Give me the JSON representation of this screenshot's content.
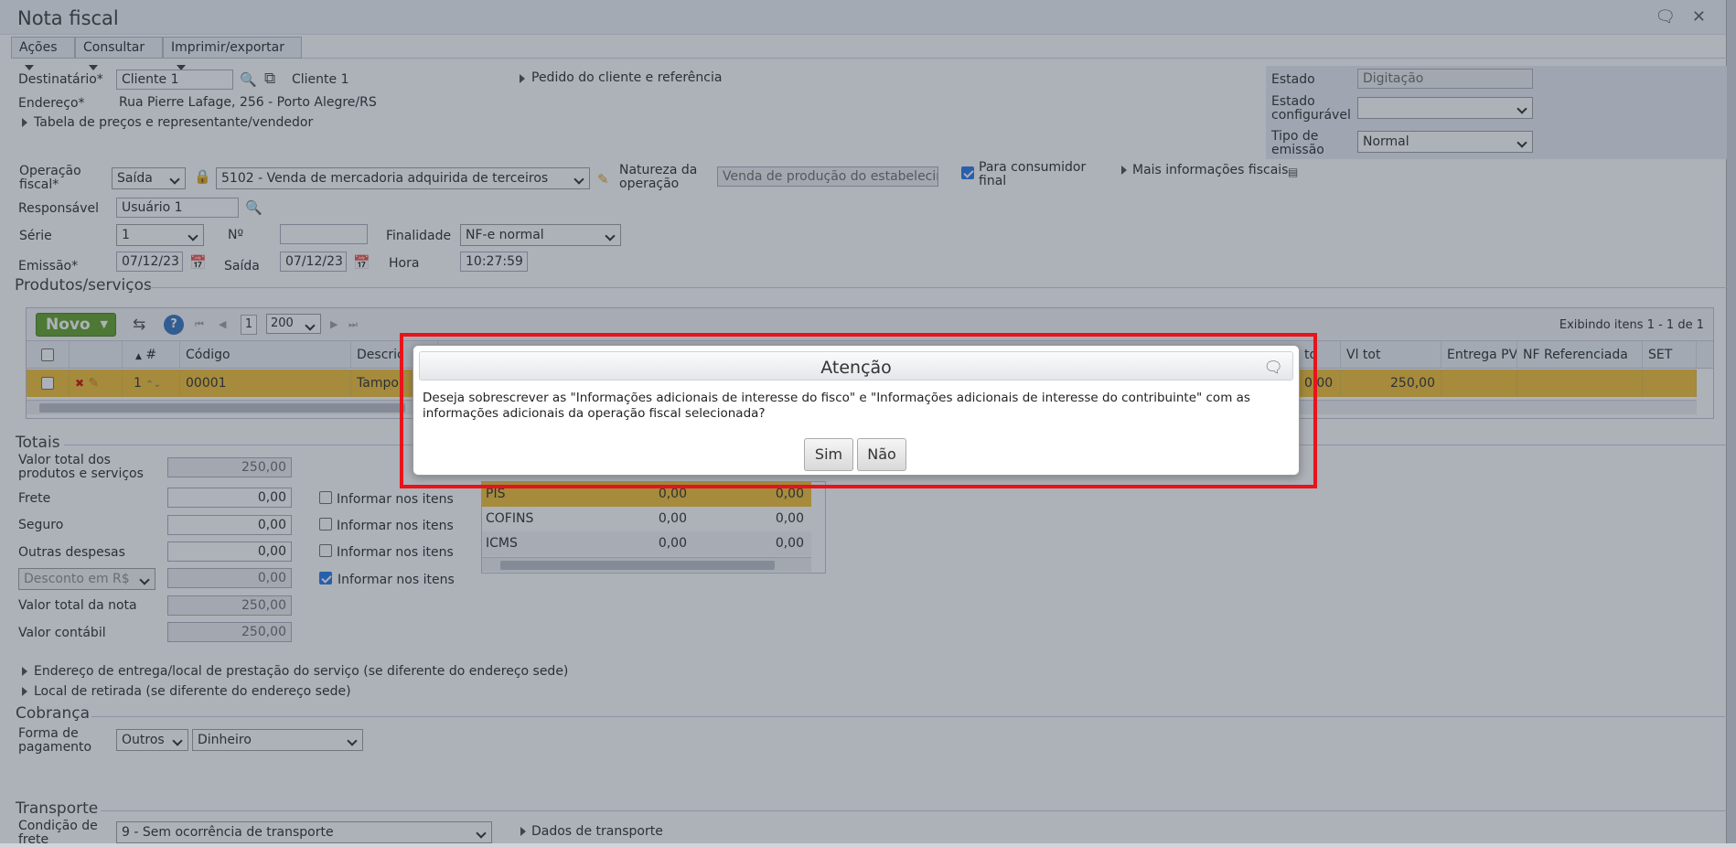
{
  "window": {
    "title": "Nota fiscal"
  },
  "menu": {
    "acoes": "Ações",
    "consultar": "Consultar",
    "imprimir": "Imprimir/exportar"
  },
  "destinatario": {
    "label": "Destinatário*",
    "value": "Cliente 1",
    "link": "Cliente 1"
  },
  "pedido_label": "Pedido do cliente e referência",
  "endereco": {
    "label": "Endereço*",
    "value": "Rua Pierre Lafage, 256 - Porto Alegre/RS"
  },
  "tabela_precos": "Tabela de preços e representante/vendedor",
  "side": {
    "estado_label": "Estado",
    "estado_value": "Digitação",
    "estado_conf_label": "Estado configurável",
    "estado_conf_value": "",
    "tipo_emissao_label": "Tipo de emissão",
    "tipo_emissao_value": "Normal"
  },
  "operacao": {
    "label": "Operação fiscal*",
    "tipo": "Saída",
    "cfop": "5102 - Venda de mercadoria adquirida de terceiros",
    "natureza_label": "Natureza da operação",
    "natureza_value": "Venda de produção do estabelecime",
    "consumidor_final": "Para consumidor final",
    "mais_info": "Mais informações fiscais"
  },
  "responsavel": {
    "label": "Responsável",
    "value": "Usuário 1"
  },
  "serie": {
    "label": "Série",
    "value": "1",
    "no_label": "Nº",
    "no_value": ""
  },
  "finalidade": {
    "label": "Finalidade",
    "value": "NF-e normal"
  },
  "emissao": {
    "label": "Emissão*",
    "value": "07/12/23"
  },
  "saida": {
    "label": "Saída",
    "value": "07/12/23"
  },
  "hora": {
    "label": "Hora",
    "value": "10:27:59"
  },
  "produtos": {
    "title": "Produtos/serviços",
    "novo": "Novo",
    "page": "1",
    "page_size": "200",
    "exibindo": "Exibindo itens 1 - 1 de 1",
    "headers": [
      "#",
      "Código",
      "Descriç",
      "Vl tot",
      "Entrega PV",
      "NF Referenciada",
      "SET"
    ],
    "row": {
      "n": "1",
      "codigo": "00001",
      "descricao": "Tampo",
      "unit_fragment": "0,00",
      "vl_tot": "250,00",
      "unit_header_fragment": "to"
    }
  },
  "totais": {
    "title": "Totais",
    "valor_total_label": "Valor total dos produtos e serviços",
    "valor_total": "250,00",
    "frete_label": "Frete",
    "frete": "0,00",
    "seguro_label": "Seguro",
    "seguro": "0,00",
    "outras_label": "Outras despesas",
    "outras": "0,00",
    "desconto_label": "Desconto em R$",
    "desconto": "0,00",
    "valor_nota_label": "Valor total da nota",
    "valor_nota": "250,00",
    "valor_contabil_label": "Valor contábil",
    "valor_contabil": "250,00",
    "informar": "Informar nos itens"
  },
  "impostos": [
    {
      "name": "PIS",
      "a": "0,00",
      "b": "0,00"
    },
    {
      "name": "COFINS",
      "a": "0,00",
      "b": "0,00"
    },
    {
      "name": "ICMS",
      "a": "0,00",
      "b": "0,00"
    }
  ],
  "endereco_entrega": "Endereço de entrega/local de prestação do serviço (se diferente do endereço sede)",
  "local_retirada": "Local de retirada (se diferente do endereço sede)",
  "cobranca": {
    "title": "Cobrança",
    "forma_label": "Forma de pagamento",
    "forma": "Outros",
    "meio": "Dinheiro"
  },
  "transporte": {
    "title": "Transporte",
    "condicao_label": "Condição de frete",
    "condicao": "9 - Sem ocorrência de transporte",
    "dados": "Dados de transporte"
  },
  "dialog": {
    "title": "Atenção",
    "message": "Deseja sobrescrever as \"Informações adicionais de interesse do fisco\" e \"Informações adicionais de interesse do contribuinte\" com as informações adicionais da operação fiscal selecionada?",
    "yes": "Sim",
    "no": "Não"
  },
  "colors": {
    "highlight": "#e8141b",
    "selected_row": "#f3be2a",
    "novo_button": "#5a9e1e"
  }
}
